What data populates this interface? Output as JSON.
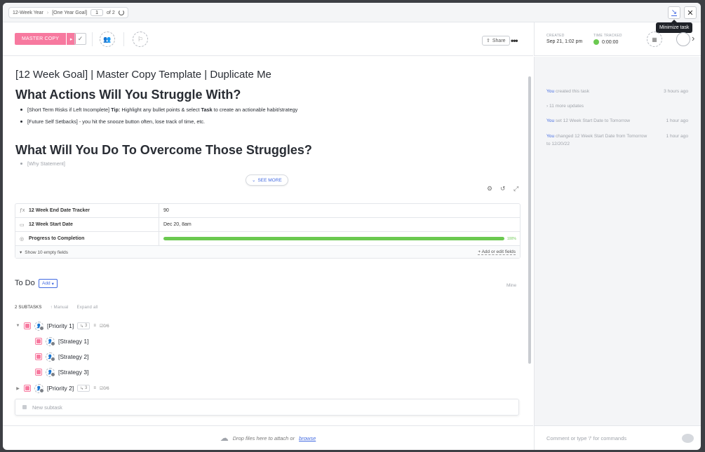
{
  "breadcrumb": {
    "workspace": "12-Week Year",
    "list": "[One Year Goal]",
    "page_current": "1",
    "page_total": "of 2"
  },
  "tooltip": "Minimize task",
  "toolbar": {
    "status": "MASTER COPY",
    "share": "Share"
  },
  "meta": {
    "created_label": "CREATED",
    "created_value": "Sep 21, 1:02 pm",
    "time_label": "TIME TRACKED",
    "time_value": "0:00:00"
  },
  "task": {
    "title": "[12 Week Goal] | Master Copy Template | Duplicate Me",
    "heading1": "What Actions Will You Struggle With?",
    "bullets1": [
      {
        "pre": "[Short Term Risks if Left Incomplete] ",
        "bold1": "Tip:",
        "mid": " Highlight any bullet points & select ",
        "bold2": "Task",
        "post": " to create an actionable habit/strategy"
      },
      {
        "text": "[Future Self Setbacks] - you hit the snooze button often, lose track of time, etc."
      }
    ],
    "heading2": "What Will You Do To Overcome Those Struggles?",
    "bullets2": [
      "[Why Statement]"
    ],
    "see_more": "SEE MORE"
  },
  "fields": {
    "rows": [
      {
        "icon": "fx",
        "name": "12 Week End Date Tracker",
        "value": "90"
      },
      {
        "icon": "calendar",
        "name": "12 Week Start Date",
        "value": "Dec 20, 8am"
      },
      {
        "icon": "progress",
        "name": "Progress to Completion",
        "value": "100%",
        "progress": 1.0
      }
    ],
    "show_empty": "Show 10 empty fields",
    "add_edit": "+ Add or edit fields"
  },
  "todo": {
    "title": "To Do",
    "add": "Add",
    "mine": "Mine"
  },
  "subtasks": {
    "count": "2 SUBTASKS",
    "sort": "Manual",
    "expand": "Expand all",
    "items": [
      {
        "name": "[Priority 1]",
        "subs": "3",
        "checklist": "0/6"
      },
      {
        "name": "[Strategy 1]"
      },
      {
        "name": "[Strategy 2]"
      },
      {
        "name": "[Strategy 3]"
      },
      {
        "name": "[Priority 2]",
        "subs": "3",
        "checklist": "0/6"
      }
    ],
    "new_placeholder": "New subtask"
  },
  "attach": {
    "text": "Drop files here to attach or",
    "link": "browse"
  },
  "activity": [
    {
      "who": "You",
      "text": "created this task",
      "time": "3 hours ago"
    },
    {
      "who": "",
      "text": "11 more updates",
      "time": ""
    },
    {
      "who": "You",
      "text": "set 12 Week Start Date to Tomorrow",
      "time": "1 hour ago"
    },
    {
      "who": "You",
      "text": "changed 12 Week Start Date from Tomorrow to 12/20/22",
      "time": "1 hour ago"
    }
  ],
  "comment_placeholder": "Comment or type '/' for commands",
  "colors": {
    "status": "#f7799f",
    "progress": "#6bc950",
    "link": "#4169e1"
  }
}
